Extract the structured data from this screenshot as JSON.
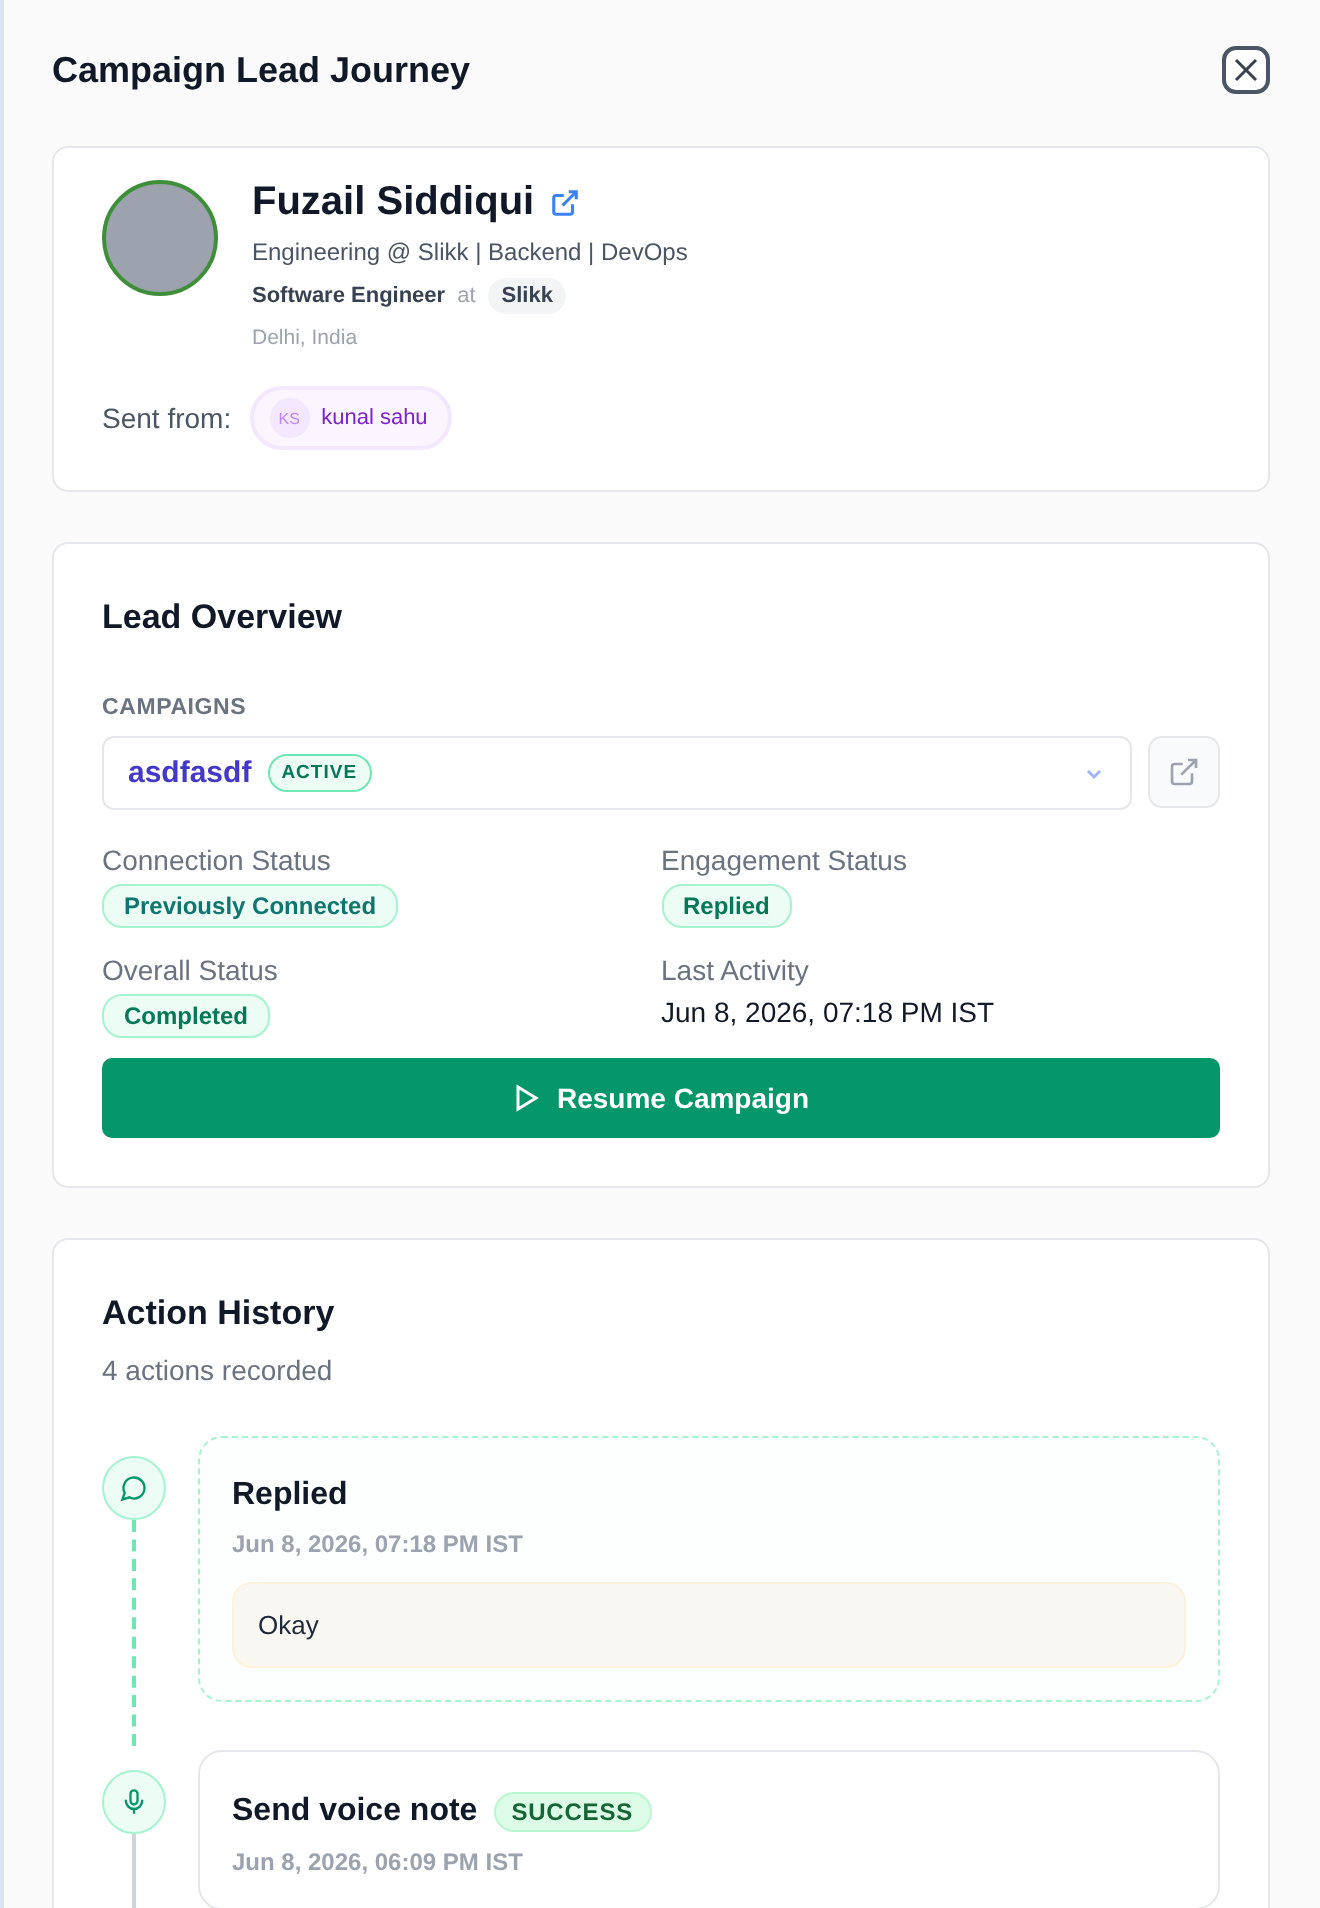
{
  "title": "Campaign Lead Journey",
  "lead": {
    "name": "Fuzail Siddiqui",
    "headline": "Engineering @ Slikk | Backend | DevOps",
    "role": "Software Engineer",
    "at": "at",
    "company": "Slikk",
    "location": "Delhi, India",
    "sent_from_label": "Sent from:",
    "sender_initials": "KS",
    "sender_name": "kunal sahu"
  },
  "overview": {
    "title": "Lead Overview",
    "campaigns_label": "CAMPAIGNS",
    "campaign": "asdfasdf",
    "campaign_status": "ACTIVE",
    "fields": [
      {
        "label": "Connection Status",
        "kind": "badge",
        "value": "Previously Connected",
        "color": "#0f766e"
      },
      {
        "label": "Engagement Status",
        "kind": "badge",
        "value": "Replied",
        "color": "#047857"
      },
      {
        "label": "Overall Status",
        "kind": "badge",
        "value": "Completed",
        "color": "#047857"
      },
      {
        "label": "Last Activity",
        "kind": "text",
        "value": "Jun 8, 2026, 07:18 PM IST"
      }
    ],
    "button": "Resume Campaign"
  },
  "history": {
    "title": "Action History",
    "count": "4 actions recorded",
    "actions": [
      {
        "kind": "reply",
        "title": "Replied",
        "latest": true,
        "time": "Jun 8, 2026, 07:18 PM IST",
        "message": "Okay"
      },
      {
        "kind": "voice_note",
        "title": "Send voice note",
        "latest": false,
        "status": "SUCCESS",
        "time": "Jun 8, 2026, 06:09 PM IST"
      }
    ]
  }
}
